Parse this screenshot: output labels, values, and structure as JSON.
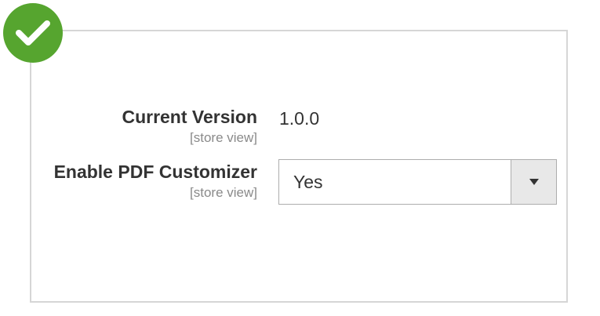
{
  "badge": {
    "icon": "check-icon",
    "color": "#56a52f"
  },
  "fields": {
    "current_version": {
      "label": "Current Version",
      "scope": "[store view]",
      "value": "1.0.0"
    },
    "enable_pdf_customizer": {
      "label": "Enable PDF Customizer",
      "scope": "[store view]",
      "selected": "Yes"
    }
  }
}
